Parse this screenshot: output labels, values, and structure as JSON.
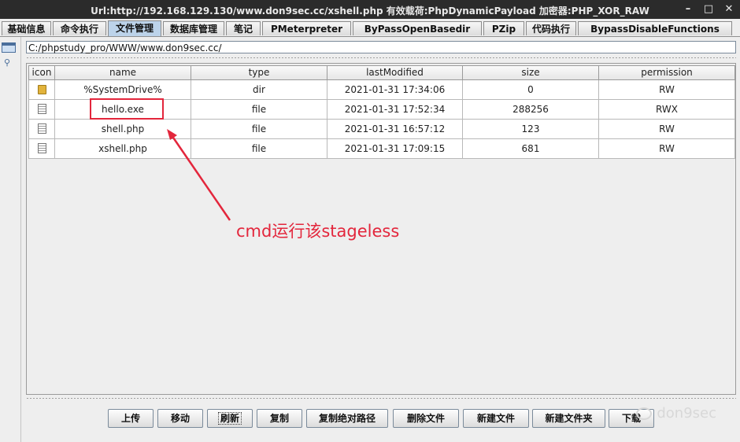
{
  "window": {
    "title": "Url:http://192.168.129.130/www.don9sec.cc/xshell.php 有效载荷:PhpDynamicPayload 加密器:PHP_XOR_RAW"
  },
  "tabs": [
    {
      "label": "基础信息"
    },
    {
      "label": "命令执行"
    },
    {
      "label": "文件管理"
    },
    {
      "label": "数据库管理"
    },
    {
      "label": "笔记"
    },
    {
      "label": "PMeterpreter"
    },
    {
      "label": "ByPassOpenBasedir"
    },
    {
      "label": "PZip"
    },
    {
      "label": "代码执行"
    },
    {
      "label": "BypassDisableFunctions"
    }
  ],
  "active_tab": "文件管理",
  "path": {
    "value": "C:/phpstudy_pro/WWW/www.don9sec.cc/"
  },
  "table": {
    "columns": [
      "icon",
      "name",
      "type",
      "lastModified",
      "size",
      "permission"
    ],
    "rows": [
      {
        "icon": "folder-icon",
        "name": "%SystemDrive%",
        "type": "dir",
        "lastModified": "2021-01-31 17:34:06",
        "size": "0",
        "permission": "RW"
      },
      {
        "icon": "file-icon",
        "name": "hello.exe",
        "type": "file",
        "lastModified": "2021-01-31 17:52:34",
        "size": "288256",
        "permission": "RWX"
      },
      {
        "icon": "file-icon",
        "name": "shell.php",
        "type": "file",
        "lastModified": "2021-01-31 16:57:12",
        "size": "123",
        "permission": "RW"
      },
      {
        "icon": "file-icon",
        "name": "xshell.php",
        "type": "file",
        "lastModified": "2021-01-31 17:09:15",
        "size": "681",
        "permission": "RW"
      }
    ]
  },
  "annotation": {
    "text": "cmd运行该stageless",
    "color": "#e3263c"
  },
  "buttons": [
    {
      "label": "上传"
    },
    {
      "label": "移动"
    },
    {
      "label": "刷新"
    },
    {
      "label": "复制"
    },
    {
      "label": "复制绝对路径"
    },
    {
      "label": "删除文件"
    },
    {
      "label": "新建文件"
    },
    {
      "label": "新建文件夹"
    },
    {
      "label": "下载"
    }
  ],
  "watermark": {
    "text": "don9sec"
  }
}
